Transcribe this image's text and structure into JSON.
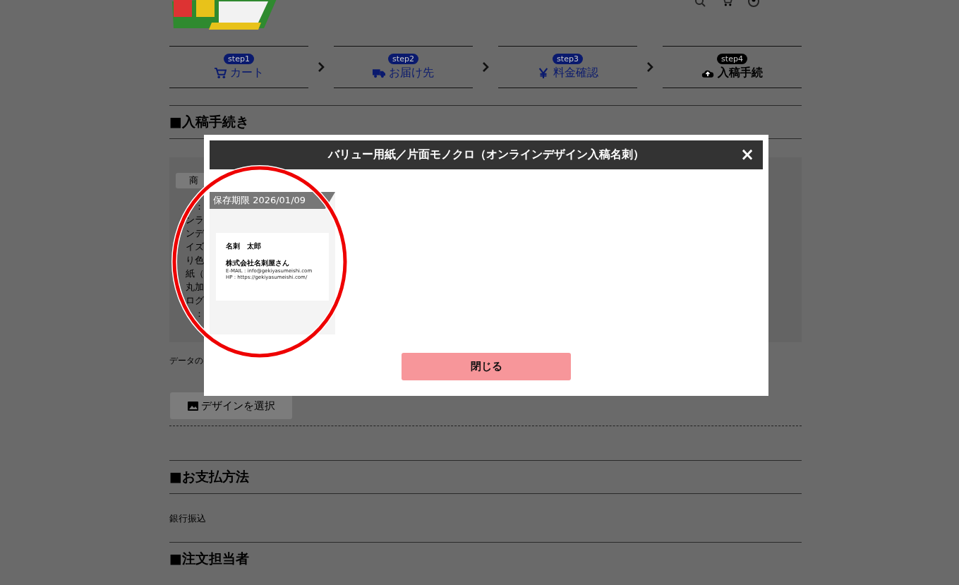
{
  "steps": [
    {
      "badge": "step1",
      "label": "カート",
      "kind": "cart",
      "selected": false
    },
    {
      "badge": "step2",
      "label": "お届け先",
      "kind": "delivery",
      "selected": false
    },
    {
      "badge": "step3",
      "label": "料金確認",
      "kind": "price",
      "selected": false
    },
    {
      "badge": "step4",
      "label": "入稿手続",
      "kind": "upload",
      "selected": true
    }
  ],
  "sections": [
    {
      "kind": "upload",
      "heading": "■入稿手続き",
      "product_tag": "商",
      "info_lines": [
        "：",
        "ンラ",
        "ンデ",
        "イズ",
        "り色",
        "紙（",
        "丸加",
        "ログ",
        "："
      ],
      "data_note": "データの",
      "design_button": "デザインを選択"
    },
    {
      "kind": "text",
      "heading": "■お支払方法",
      "body": "銀行振込"
    },
    {
      "kind": "heading",
      "heading": "■注文担当者"
    }
  ],
  "modal": {
    "title": "バリュー用紙／片面モノクロ（オンラインデザイン入稿名刺）",
    "close": "×",
    "design": {
      "expiry": "保存期限 2026/01/09",
      "card_name": "名刺　太郎",
      "card_company": "株式会社名刺屋さん",
      "card_email": "E-MAIL : info@gekiyasumeishi.com",
      "card_url": "HP : https://gekiyasumeishi.com/"
    },
    "button": "閉じる"
  }
}
